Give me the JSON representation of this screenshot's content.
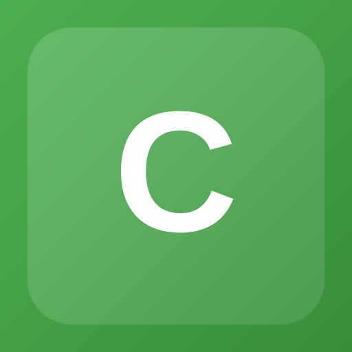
{
  "icon": {
    "letter": "C",
    "background_color": "#43a047",
    "tile_color": "rgba(255,255,255,0.13)",
    "letter_color": "#ffffff"
  }
}
